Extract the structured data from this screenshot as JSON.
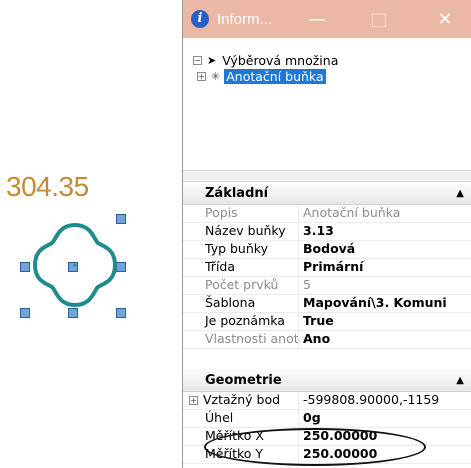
{
  "drawing": {
    "cell_label": "304.35"
  },
  "window": {
    "title": "Inform...",
    "minimize_glyph": "—",
    "maximize_glyph": "□",
    "close_glyph": "✕"
  },
  "tree": {
    "root_label": "Výběrová množina",
    "child_label": "Anotační buňka"
  },
  "sections": {
    "basic": {
      "title": "Základní",
      "rows": [
        {
          "key": "Popis",
          "value": "Anotační buňka"
        },
        {
          "key": "Název buňky",
          "value": "3.13"
        },
        {
          "key": "Typ buňky",
          "value": "Bodová"
        },
        {
          "key": "Třída",
          "value": "Primární"
        },
        {
          "key": "Počet prvků",
          "value": "5"
        },
        {
          "key": "Šablona",
          "value": "Mapování\\3. Komuni"
        },
        {
          "key": "Je poznámka",
          "value": "True"
        },
        {
          "key": "Vlastnosti anotac",
          "value": "Ano"
        }
      ]
    },
    "geometry": {
      "title": "Geometrie",
      "rows": [
        {
          "key": "Vztažný bod",
          "value": "-599808.90000,-1159"
        },
        {
          "key": "Úhel",
          "value": "0g"
        },
        {
          "key": "Měřítko X",
          "value": "250.00000"
        },
        {
          "key": "Měřítko Y",
          "value": "250.00000"
        }
      ]
    }
  },
  "colors": {
    "title_bar": "#ebb8a6",
    "selection": "#1e78d6",
    "cell_text": "#c58a35",
    "cell_shape": "#1f8c8c",
    "handle": "#6fa3d9"
  }
}
